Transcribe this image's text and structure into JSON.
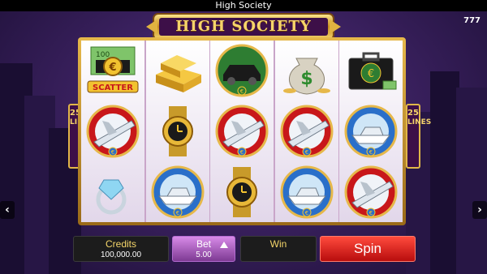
{
  "window": {
    "title": "High Society"
  },
  "logo": {
    "text": "HIGH SOCIETY",
    "brand": "777"
  },
  "paylines": {
    "count": "25",
    "label": "LINES"
  },
  "reels": [
    [
      "scatter",
      "plane",
      "ring"
    ],
    [
      "gold-bars",
      "watch",
      "yacht"
    ],
    [
      "limousine",
      "plane",
      "watch"
    ],
    [
      "money-bag",
      "plane",
      "yacht"
    ],
    [
      "briefcase",
      "yacht",
      "plane"
    ]
  ],
  "symbols": {
    "scatter_label": "SCATTER",
    "scatter_note": "100",
    "euro": "€",
    "dollar": "$"
  },
  "controls": {
    "credits_label": "Credits",
    "credits_value": "100,000.00",
    "bet_label": "Bet",
    "bet_value": "5.00",
    "win_label": "Win",
    "spin_label": "Spin"
  },
  "nav": {
    "left": "‹",
    "right": "›"
  },
  "colors": {
    "frame_gold": "#d6a43a",
    "spin_red": "#e01f17",
    "bet_purple": "#b86ad0",
    "background_purple": "#3b2160"
  }
}
